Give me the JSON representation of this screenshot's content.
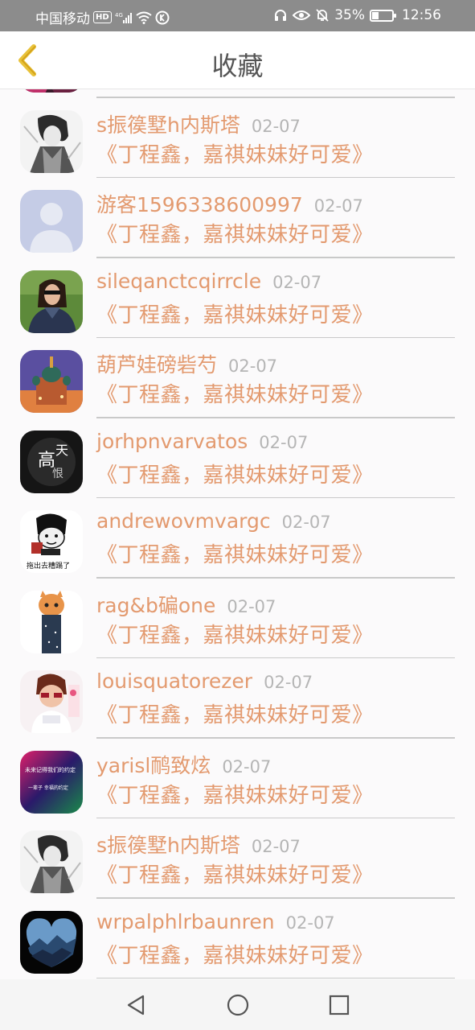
{
  "status_bar": {
    "carrier": "中国移动",
    "hd": "HD",
    "network": "4G",
    "battery_percent": "35%",
    "battery_level": 0.35,
    "time": "12:56"
  },
  "header": {
    "title": "收藏",
    "back_icon": "chevron-left-icon"
  },
  "list": {
    "items": [
      {
        "name": "",
        "date": "",
        "title": "",
        "avatar": "partial-avatar"
      },
      {
        "name": "s振篌墅h内斯塔",
        "date": "02-07",
        "title": "《丁程鑫，嘉祺妹妹好可爱》",
        "avatar": "sketch-portrait"
      },
      {
        "name": "游客1596338600997",
        "date": "02-07",
        "title": "《丁程鑫，嘉祺妹妹好可爱》",
        "avatar": "default-user"
      },
      {
        "name": "sileqanctcqirrcle",
        "date": "02-07",
        "title": "《丁程鑫，嘉祺妹妹好可爱》",
        "avatar": "woman-photo"
      },
      {
        "name": "葫芦娃磅砦芍",
        "date": "02-07",
        "title": "《丁程鑫，嘉祺妹妹好可爱》",
        "avatar": "cathedral-night"
      },
      {
        "name": "jorhpnvarvatos",
        "date": "02-07",
        "title": "《丁程鑫，嘉祺妹妹好可爱》",
        "avatar": "calligraphy-dark"
      },
      {
        "name": "andrewovmvargc",
        "date": "02-07",
        "title": "《丁程鑫，嘉祺妹妹好可爱》",
        "avatar": "meme-face"
      },
      {
        "name": "rag&b碥one",
        "date": "02-07",
        "title": "《丁程鑫，嘉祺妹妹好可爱》",
        "avatar": "cat-legs"
      },
      {
        "name": "louisquatorezer",
        "date": "02-07",
        "title": "《丁程鑫，嘉祺妹妹好可爱》",
        "avatar": "kid-sunglasses"
      },
      {
        "name": "yarisl鸸致炫",
        "date": "02-07",
        "title": "《丁程鑫，嘉祺妹妹好可爱》",
        "avatar": "gradient-text"
      },
      {
        "name": "s振篌墅h内斯塔",
        "date": "02-07",
        "title": "《丁程鑫，嘉祺妹妹好可爱》",
        "avatar": "sketch-portrait"
      },
      {
        "name": "wrpalphlrbaunren",
        "date": "02-07",
        "title": "《丁程鑫，嘉祺妹妹好可爱》",
        "avatar": "heart-landscape"
      }
    ]
  },
  "bottom_nav": {
    "back": "triangle-back-icon",
    "home": "circle-home-icon",
    "recent": "square-recent-icon"
  },
  "colors": {
    "accent": "#e39a6f",
    "date": "#b5b5b5",
    "back_chevron": "#e8c23a"
  }
}
